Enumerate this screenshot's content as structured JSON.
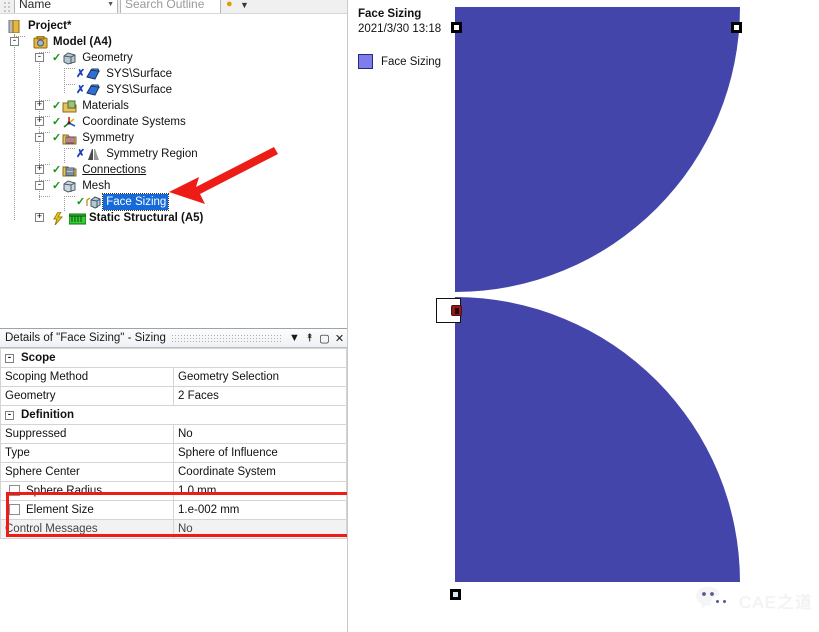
{
  "outline_toolbar": {
    "name_combo": "Name",
    "name_caret": "▼",
    "search_placeholder": "Search Outline",
    "filter_icon": "●",
    "dropdown_icon": "▼"
  },
  "tree": {
    "nodes": [
      {
        "label": "Project*",
        "icon": "project-icon",
        "indent": 0,
        "expander": "",
        "status": "",
        "bold": true,
        "underline": false,
        "selected": false
      },
      {
        "label": "Model (A4)",
        "icon": "model-icon",
        "indent": 1,
        "expander": "-",
        "status": "",
        "bold": true,
        "underline": false,
        "selected": false
      },
      {
        "label": "Geometry",
        "icon": "geometry-icon",
        "indent": 2,
        "expander": "-",
        "status": "check",
        "bold": false,
        "underline": false,
        "selected": false
      },
      {
        "label": "SYS\\Surface",
        "icon": "surface-body-icon",
        "indent": 3,
        "expander": "",
        "status": "xmark",
        "bold": false,
        "underline": false,
        "selected": false
      },
      {
        "label": "SYS\\Surface",
        "icon": "surface-body-icon",
        "indent": 3,
        "expander": "",
        "status": "xmark",
        "bold": false,
        "underline": false,
        "selected": false
      },
      {
        "label": "Materials",
        "icon": "materials-icon",
        "indent": 2,
        "expander": "+",
        "status": "check",
        "bold": false,
        "underline": false,
        "selected": false
      },
      {
        "label": "Coordinate Systems",
        "icon": "coordinate-systems-icon",
        "indent": 2,
        "expander": "+",
        "status": "check",
        "bold": false,
        "underline": false,
        "selected": false
      },
      {
        "label": "Symmetry",
        "icon": "symmetry-icon",
        "indent": 2,
        "expander": "-",
        "status": "check",
        "bold": false,
        "underline": false,
        "selected": false
      },
      {
        "label": "Symmetry Region",
        "icon": "symmetry-region-icon",
        "indent": 3,
        "expander": "",
        "status": "xmark",
        "bold": false,
        "underline": false,
        "selected": false
      },
      {
        "label": "Connections",
        "icon": "connections-icon",
        "indent": 2,
        "expander": "+",
        "status": "check",
        "bold": false,
        "underline": true,
        "selected": false
      },
      {
        "label": "Mesh",
        "icon": "mesh-icon",
        "indent": 2,
        "expander": "-",
        "status": "check",
        "bold": false,
        "underline": false,
        "selected": false
      },
      {
        "label": "Face Sizing",
        "icon": "face-sizing-icon",
        "indent": 3,
        "expander": "",
        "status": "check",
        "bold": false,
        "underline": false,
        "selected": true
      },
      {
        "label": "Static Structural (A5)",
        "icon": "static-structural-icon",
        "indent": 2,
        "expander": "+",
        "status": "lightning",
        "bold": true,
        "underline": false,
        "selected": false
      }
    ]
  },
  "details": {
    "title": "Details of \"Face Sizing\" - Sizing",
    "buttons": {
      "dropdown": "▼",
      "pin": "⯭",
      "maximize": "▢",
      "close": "✕"
    },
    "rows": [
      {
        "type": "group",
        "expander": "-",
        "label": "Scope"
      },
      {
        "type": "prop",
        "key": "Scoping Method",
        "value": "Geometry Selection",
        "checkbox": false,
        "greyed": false
      },
      {
        "type": "prop",
        "key": "Geometry",
        "value": "2 Faces",
        "checkbox": false,
        "greyed": false
      },
      {
        "type": "group",
        "expander": "-",
        "label": "Definition"
      },
      {
        "type": "prop",
        "key": "Suppressed",
        "value": "No",
        "checkbox": false,
        "greyed": false
      },
      {
        "type": "prop",
        "key": "Type",
        "value": "Sphere of Influence",
        "checkbox": false,
        "greyed": false
      },
      {
        "type": "prop",
        "key": "Sphere Center",
        "value": "Coordinate System",
        "checkbox": false,
        "greyed": false
      },
      {
        "type": "prop",
        "key": "Sphere Radius",
        "value": "1.0 mm",
        "checkbox": true,
        "greyed": false
      },
      {
        "type": "prop",
        "key": "Element Size",
        "value": "1.e-002 mm",
        "checkbox": true,
        "greyed": false
      },
      {
        "type": "prop",
        "key": "Control Messages",
        "value": "No",
        "checkbox": false,
        "greyed": true
      }
    ]
  },
  "viewport": {
    "title": "Face Sizing",
    "timestamp": "2021/3/30 13:18",
    "legend": {
      "swatch_color": "#7d7ded",
      "label": "Face Sizing"
    },
    "body_color": "#4345ab",
    "watermark_text": "CAE之道",
    "watermark_icon": "wechat-icon"
  },
  "annotation": {
    "arrow_color": "#ee1c16",
    "highlight_box_color": "#ee1c16"
  }
}
